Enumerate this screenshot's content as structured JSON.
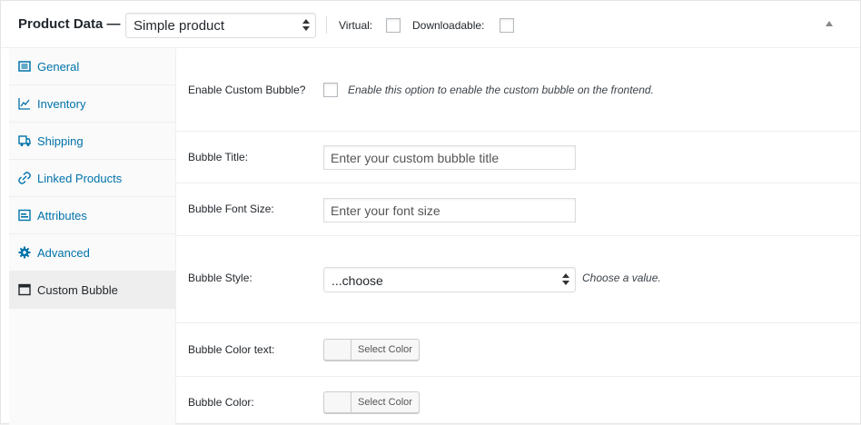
{
  "header": {
    "title": "Product Data —",
    "product_type": "Simple product",
    "virtual_label": "Virtual:",
    "downloadable_label": "Downloadable:"
  },
  "sidebar": {
    "items": [
      {
        "label": "General",
        "icon": "general-icon"
      },
      {
        "label": "Inventory",
        "icon": "inventory-icon"
      },
      {
        "label": "Shipping",
        "icon": "shipping-icon"
      },
      {
        "label": "Linked Products",
        "icon": "link-icon"
      },
      {
        "label": "Attributes",
        "icon": "attributes-icon"
      },
      {
        "label": "Advanced",
        "icon": "gear-icon"
      },
      {
        "label": "Custom Bubble",
        "icon": "window-icon",
        "active": true
      }
    ]
  },
  "fields": {
    "enable": {
      "label": "Enable Custom Bubble?",
      "description": "Enable this option to enable the custom bubble on the frontend."
    },
    "title": {
      "label": "Bubble Title:",
      "placeholder": "Enter your custom bubble title"
    },
    "font_size": {
      "label": "Bubble Font Size:",
      "placeholder": "Enter your font size"
    },
    "style": {
      "label": "Bubble Style:",
      "value": "...choose",
      "description": "Choose a value."
    },
    "color_text": {
      "label": "Bubble Color text:",
      "button": "Select Color"
    },
    "color": {
      "label": "Bubble Color:",
      "button": "Select Color"
    }
  },
  "colors": {
    "link": "#0073aa",
    "active_tab_bg": "#eeeeee",
    "sidebar_bg": "#fafafa"
  }
}
